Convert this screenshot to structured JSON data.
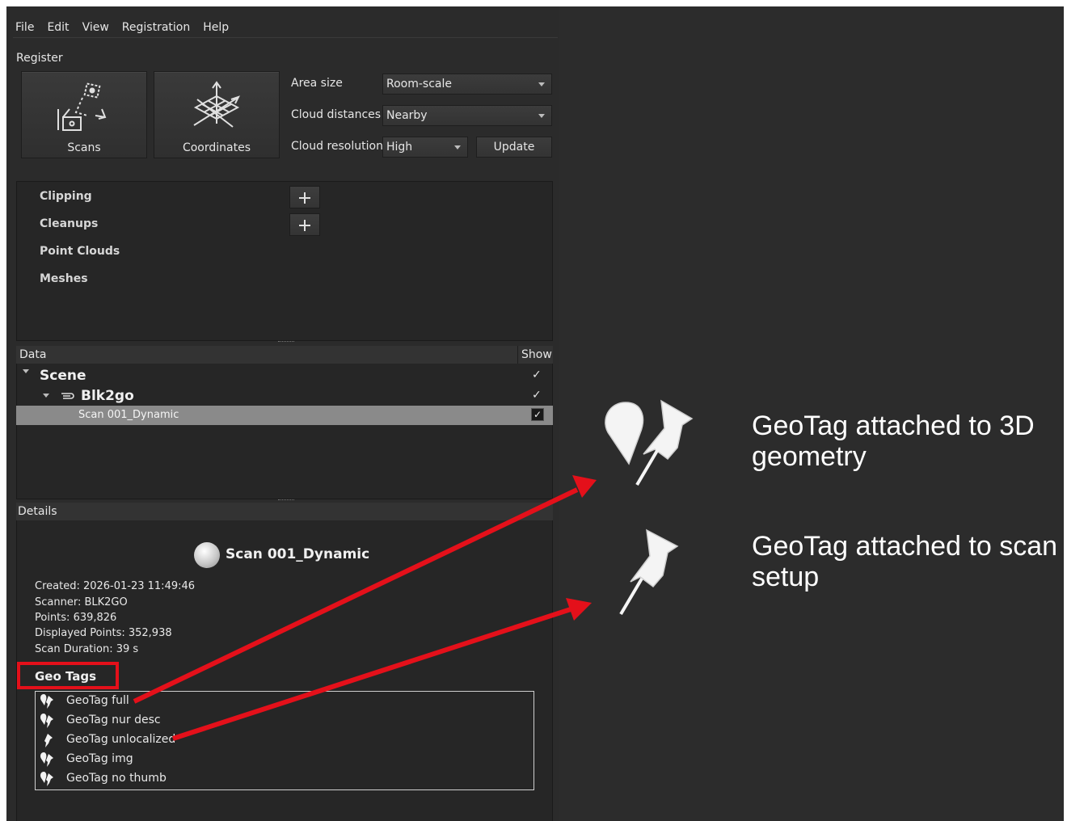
{
  "menu": [
    "File",
    "Edit",
    "View",
    "Registration",
    "Help"
  ],
  "register": {
    "label": "Register",
    "scans_label": "Scans",
    "coordinates_label": "Coordinates",
    "area_size_label": "Area size",
    "area_size_value": "Room-scale",
    "cloud_distances_label": "Cloud distances",
    "cloud_distances_value": "Nearby",
    "cloud_resolution_label": "Cloud resolution",
    "cloud_resolution_value": "High",
    "update_label": "Update"
  },
  "layers": {
    "clipping": "Clipping",
    "cleanups": "Cleanups",
    "point_clouds": "Point Clouds",
    "meshes": "Meshes"
  },
  "data_panel": {
    "header": "Data",
    "show_header": "Show",
    "scene": "Scene",
    "blk": "Blk2go",
    "scan": "Scan 001_Dynamic",
    "check": "✓"
  },
  "details": {
    "header": "Details",
    "title": "Scan 001_Dynamic",
    "created": "Created: 2026-01-23 11:49:46",
    "scanner": "Scanner: BLK2GO",
    "points": "Points: 639,826",
    "displayed_points": "Displayed Points: 352,938",
    "scan_duration": "Scan Duration: 39 s",
    "geo_tags_label": "Geo Tags",
    "geo_tags": [
      {
        "label": "GeoTag full",
        "icon": "geotag-3d-icon"
      },
      {
        "label": "GeoTag nur desc",
        "icon": "geotag-3d-icon"
      },
      {
        "label": "GeoTag unlocalized",
        "icon": "geotag-setup-icon"
      },
      {
        "label": "GeoTag img",
        "icon": "geotag-3d-icon"
      },
      {
        "label": "GeoTag no thumb",
        "icon": "geotag-3d-icon"
      }
    ]
  },
  "legend": {
    "geometry": "GeoTag attached to 3D geometry",
    "setup": "GeoTag attached to scan setup"
  },
  "colors": {
    "annotation_red": "#e4101a",
    "background": "#2c2c2c",
    "selected_row": "#8a8a8a"
  }
}
